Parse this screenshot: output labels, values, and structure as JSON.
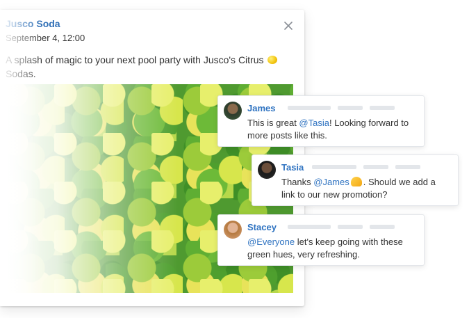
{
  "post": {
    "brand": "Jusco Soda",
    "date": "September 4,  12:00",
    "text_line1": "A splash of magic to your next pool party with Jusco's Citrus",
    "text_line2": "Sodas.",
    "emoji": "lemon-icon"
  },
  "comments": [
    {
      "author": "James",
      "body_pre": "This is great ",
      "mention": "@Tasia",
      "body_post": "! Looking forward to more posts like this."
    },
    {
      "author": "Tasia",
      "body_pre": "Thanks ",
      "mention": "@James",
      "body_post": ". Should we add a link to our new promotion?"
    },
    {
      "author": "Stacey",
      "body_pre": "",
      "mention": "@Everyone",
      "body_post": " let's keep going with these green hues, very refreshing."
    }
  ],
  "colors": {
    "brand": "#2f6fb6",
    "mention": "#2f73c1",
    "border": "#e3e6ea"
  }
}
